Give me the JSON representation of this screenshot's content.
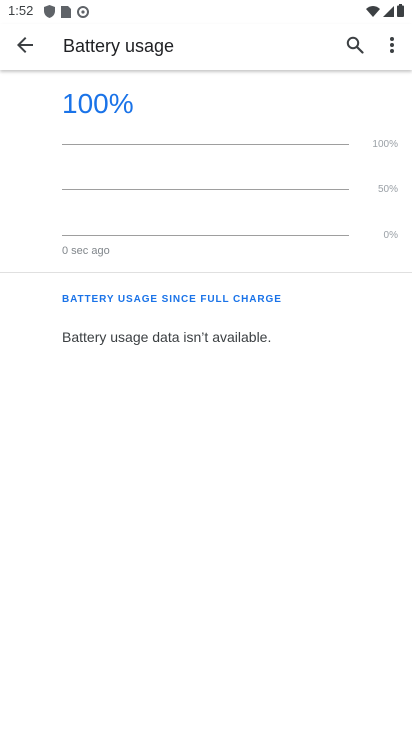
{
  "status_bar": {
    "time": "1:52"
  },
  "app_bar": {
    "title": "Battery usage",
    "back_icon": "arrow-back-icon",
    "search_icon": "search-icon",
    "more_icon": "more-vert-icon"
  },
  "graph": {
    "level": "100%",
    "labels": [
      "100%",
      "50%",
      "0%"
    ],
    "time_label": "0 sec ago"
  },
  "section": {
    "header": "BATTERY USAGE SINCE FULL CHARGE",
    "message": "Battery usage data isn’t available."
  },
  "colors": {
    "accent": "#1a73e8",
    "gridline": "#9e9e9e"
  }
}
